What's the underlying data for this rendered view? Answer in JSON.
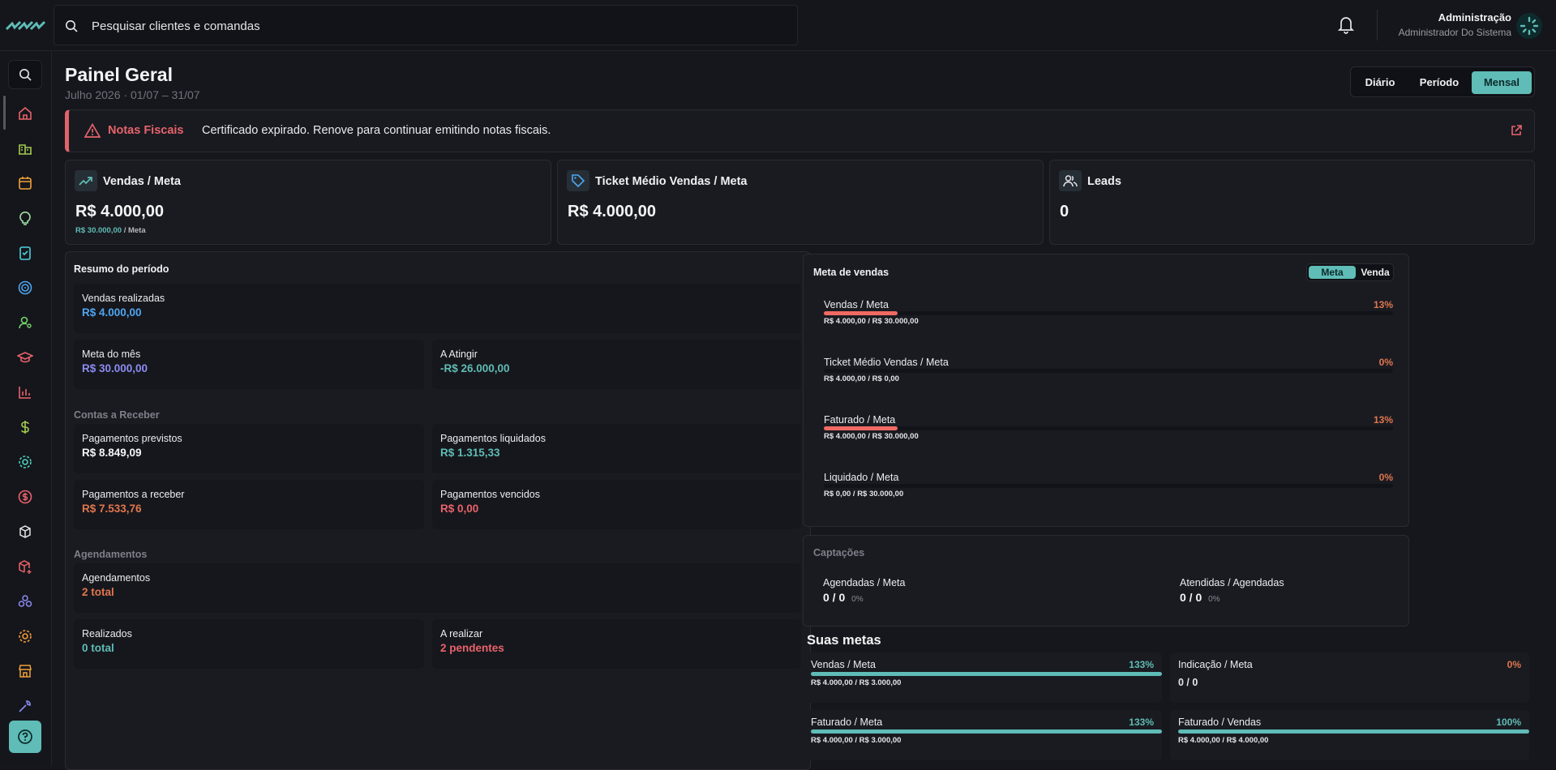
{
  "header": {
    "search_placeholder": "Pesquisar clientes e comandas",
    "user_name": "Administração",
    "user_role": "Administrador Do Sistema"
  },
  "page": {
    "title": "Painel Geral",
    "subtitle": "Julho 2026 · 01/07 – 31/07",
    "periods": [
      "Diário",
      "Período",
      "Mensal"
    ],
    "active_period": "Mensal"
  },
  "alert": {
    "title": "Notas Fiscais",
    "message": "Certificado expirado. Renove para continuar emitindo notas fiscais."
  },
  "kpis": [
    {
      "label": "Vendas / Meta",
      "value": "R$ 4.000,00",
      "meta_value": "R$ 30.000,00",
      "meta_suffix": "/ Meta",
      "icon": "trending-up-icon"
    },
    {
      "label": "Ticket Médio Vendas / Meta",
      "value": "R$ 4.000,00",
      "icon": "tag-icon"
    },
    {
      "label": "Leads",
      "value": "0",
      "icon": "users-icon"
    }
  ],
  "resumo": {
    "title": "Resumo do período",
    "vendas": {
      "label": "Vendas realizadas",
      "value": "R$ 4.000,00"
    },
    "meta_mes": {
      "label": "Meta do mês",
      "value": "R$ 30.000,00"
    },
    "a_atingir": {
      "label": "A Atingir",
      "value": "-R$ 26.000,00"
    },
    "contas_title": "Contas a Receber",
    "previstos": {
      "label": "Pagamentos previstos",
      "value": "R$ 8.849,09"
    },
    "liquidados": {
      "label": "Pagamentos liquidados",
      "value": "R$ 1.315,33"
    },
    "a_receber": {
      "label": "Pagamentos a receber",
      "value": "R$ 7.533,76"
    },
    "vencidos": {
      "label": "Pagamentos vencidos",
      "value": "R$ 0,00"
    },
    "agend_title": "Agendamentos",
    "agendamentos": {
      "label": "Agendamentos",
      "value": "2 total"
    },
    "realizados": {
      "label": "Realizados",
      "value": "0 total"
    },
    "a_realizar": {
      "label": "A realizar",
      "value": "2 pendentes"
    }
  },
  "meta_vendas": {
    "title": "Meta de vendas",
    "toggle": [
      "Meta",
      "Venda"
    ],
    "items": [
      {
        "label": "Vendas / Meta",
        "pct": "13%",
        "progress": 0.13,
        "detail": "R$ 4.000,00  /  R$ 30.000,00"
      },
      {
        "label": "Ticket Médio Vendas / Meta",
        "pct": "0%",
        "progress": 0,
        "detail": "R$ 4.000,00  /  R$ 0,00"
      },
      {
        "label": "Faturado / Meta",
        "pct": "13%",
        "progress": 0.13,
        "detail": "R$ 4.000,00  /  R$ 30.000,00"
      },
      {
        "label": "Liquidado / Meta",
        "pct": "0%",
        "progress": 0,
        "detail": "R$ 0,00  /  R$ 30.000,00"
      }
    ]
  },
  "captacoes": {
    "title": "Captações",
    "a": {
      "label": "Agendadas / Meta",
      "value": "0 / 0",
      "pct": "0%"
    },
    "b": {
      "label": "Atendidas / Agendadas",
      "value": "0 / 0",
      "pct": "0%"
    }
  },
  "suas_metas": {
    "title": "Suas metas",
    "items": [
      {
        "label": "Vendas / Meta",
        "pct": "133%",
        "progress": 1,
        "detail": "R$ 4.000,00  /  R$ 3.000,00"
      },
      {
        "label": "Indicação / Meta",
        "pct": "0%",
        "progress": 0,
        "detail": "0 / 0"
      },
      {
        "label": "Faturado / Meta",
        "pct": "133%",
        "progress": 1,
        "detail": "R$ 4.000,00  /  R$ 3.000,00"
      },
      {
        "label": "Faturado / Vendas",
        "pct": "100%",
        "progress": 1,
        "detail": "R$ 4.000,00  /  R$ 4.000,00"
      }
    ]
  },
  "sidebar": {
    "icons": [
      "home-icon",
      "buildings-icon",
      "calendar-icon",
      "lightbulb-icon",
      "checklist-icon",
      "target-icon",
      "user-search-icon",
      "graduation-cap-icon",
      "bar-chart-icon",
      "dollar-icon",
      "settings-gear-icon",
      "coin-icon",
      "package-icon",
      "package-add-icon",
      "boxes-icon",
      "cog-icon",
      "store-icon",
      "wrench-icon"
    ]
  },
  "colors": {
    "accent": "#5fbcb6",
    "danger": "#e8636b",
    "warning": "#e0764e",
    "blue": "#4ea6f0",
    "purple": "#8c8cf2"
  }
}
